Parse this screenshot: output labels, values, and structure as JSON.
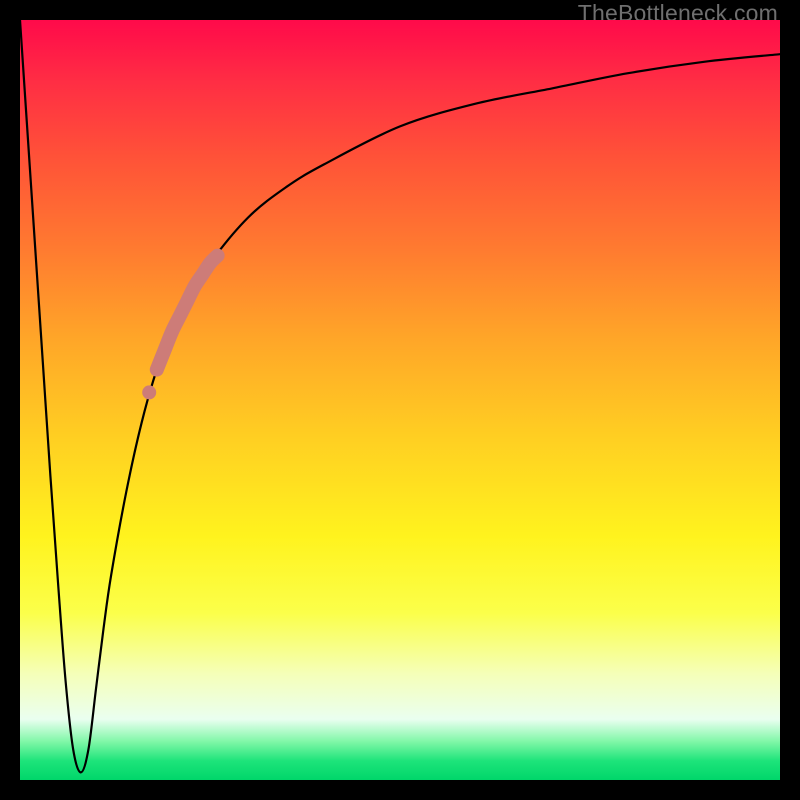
{
  "watermark": "TheBottleneck.com",
  "colors": {
    "frame": "#000000",
    "curve": "#000000",
    "highlight": "#cd7c78",
    "gradient_top": "#ff0a4a",
    "gradient_bottom": "#00d66a"
  },
  "chart_data": {
    "type": "line",
    "title": "",
    "xlabel": "",
    "ylabel": "",
    "xlim": [
      0,
      100
    ],
    "ylim": [
      0,
      100
    ],
    "grid": false,
    "legend": false,
    "series": [
      {
        "name": "bottleneck-curve",
        "x": [
          0,
          1,
          2,
          3,
          4,
          5,
          6,
          7,
          8,
          9,
          10,
          11,
          12,
          14,
          16,
          18,
          20,
          22,
          25,
          30,
          35,
          40,
          50,
          60,
          70,
          80,
          90,
          100
        ],
        "y": [
          100,
          85,
          70,
          55,
          40,
          26,
          13,
          4,
          1,
          4,
          12,
          20,
          27,
          38,
          47,
          54,
          59,
          63,
          68,
          74,
          78,
          81,
          86,
          89,
          91,
          93,
          94.5,
          95.5
        ]
      },
      {
        "name": "highlight-segment",
        "x": [
          16,
          17,
          18,
          19,
          20,
          21,
          22,
          23,
          24,
          25,
          26
        ],
        "y": [
          47,
          51,
          54,
          56.5,
          59,
          61,
          63,
          65,
          66.5,
          68,
          69
        ]
      }
    ],
    "annotations": [
      {
        "text": "TheBottleneck.com",
        "position": "top-right"
      }
    ]
  }
}
